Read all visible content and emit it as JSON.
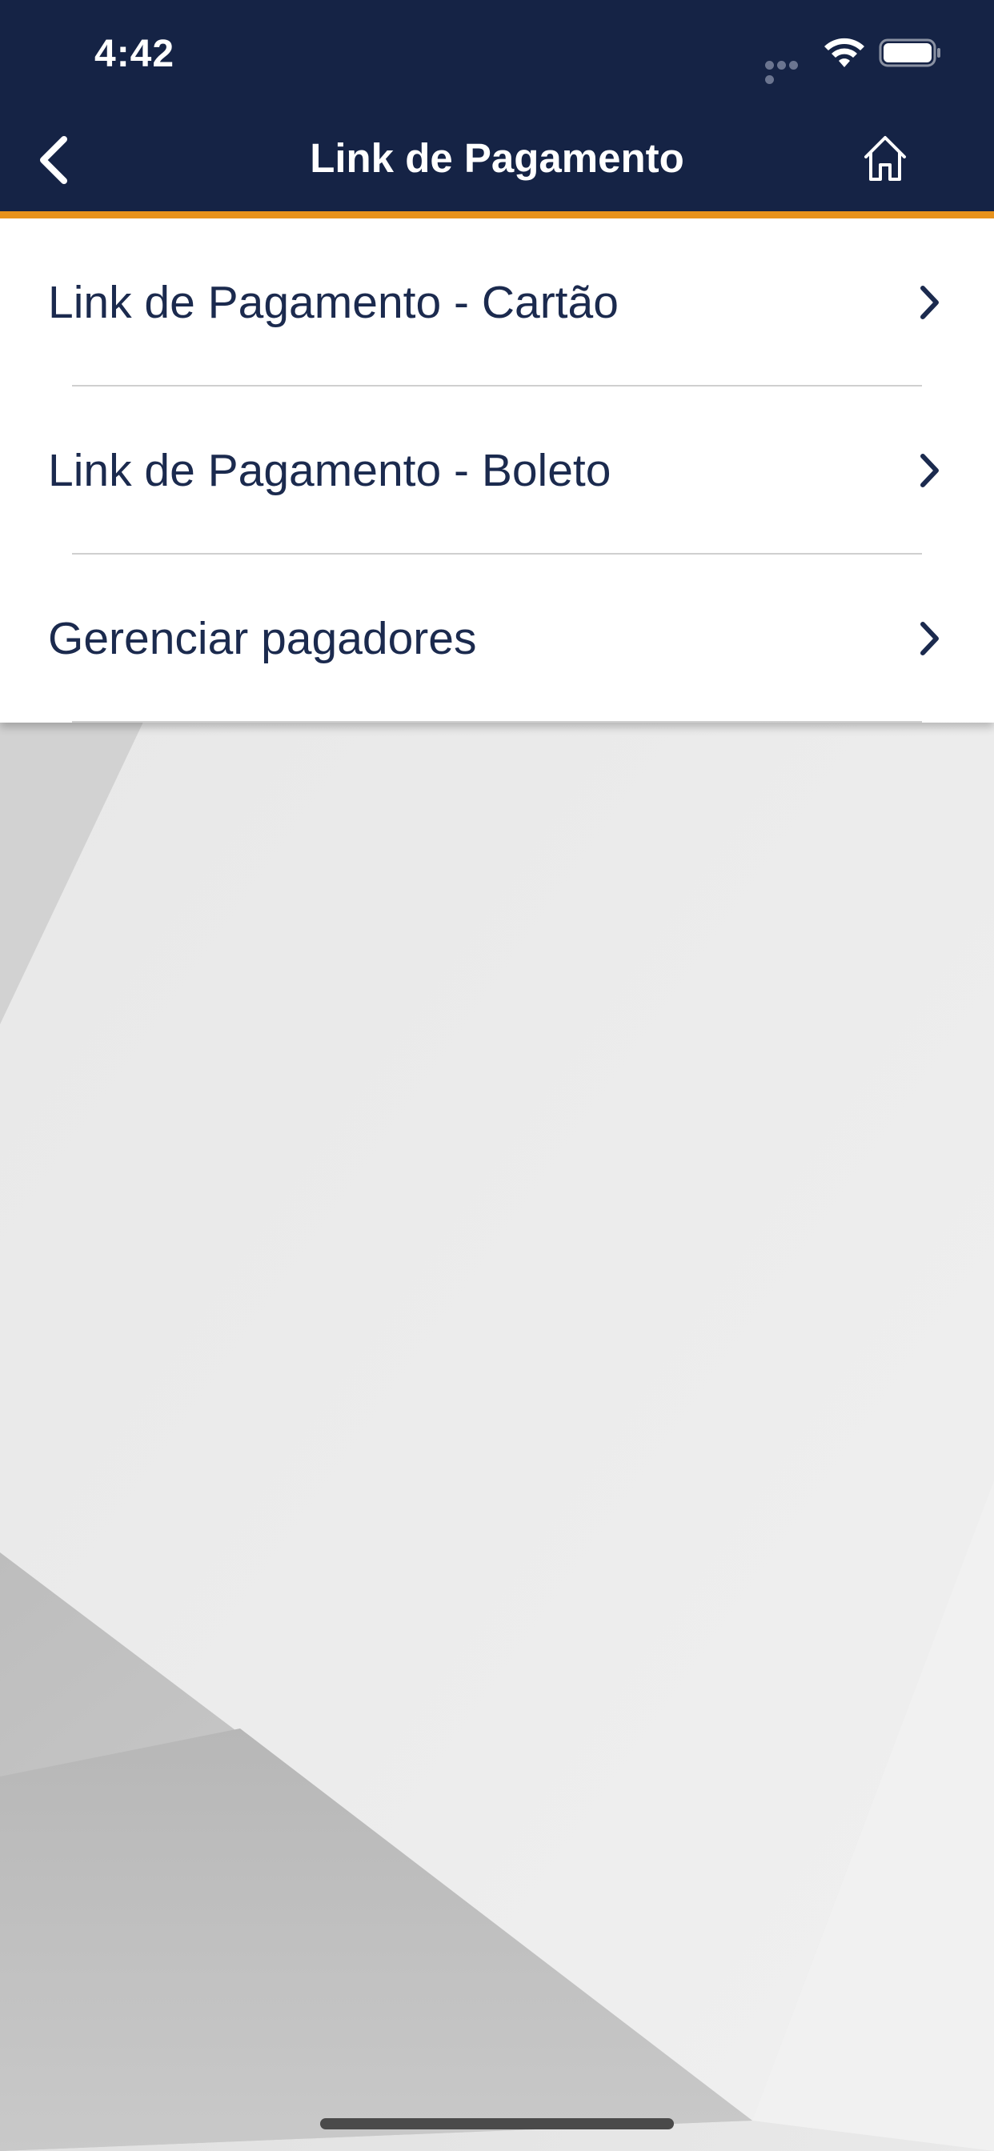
{
  "status_bar": {
    "time": "4:42"
  },
  "header": {
    "title": "Link de Pagamento",
    "back_icon": "chevron-left-icon",
    "home_icon": "home-icon",
    "background_color": "#152345",
    "accent_color": "#e8921b"
  },
  "menu": {
    "items": [
      {
        "label": "Link de Pagamento - Cartão",
        "icon": "chevron-right-icon"
      },
      {
        "label": "Link de Pagamento - Boleto",
        "icon": "chevron-right-icon"
      },
      {
        "label": "Gerenciar pagadores",
        "icon": "chevron-right-icon"
      }
    ],
    "text_color": "#1b2a4e"
  }
}
